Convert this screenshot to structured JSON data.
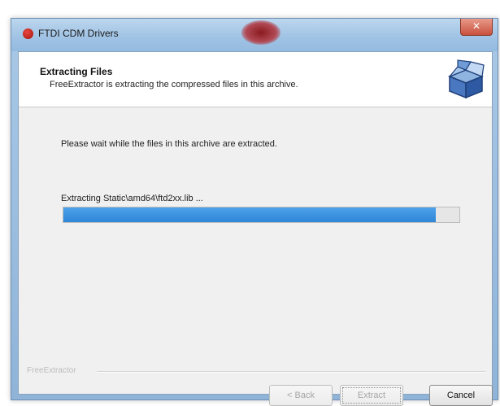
{
  "window": {
    "title": "FTDI CDM Drivers"
  },
  "header": {
    "title": "Extracting Files",
    "subtitle": "FreeExtractor is extracting the compressed files in this archive."
  },
  "body": {
    "message": "Please wait while the files in this archive are extracted."
  },
  "progress": {
    "label": "Extracting Static\\amd64\\ftd2xx.lib ...",
    "fraction": 0.94
  },
  "footer": {
    "brand": "FreeExtractor"
  },
  "buttons": {
    "back": "< Back",
    "extract": "Extract",
    "cancel": "Cancel"
  },
  "icons": {
    "app": "app-icon",
    "close": "close-icon",
    "box": "package-icon"
  },
  "colors": {
    "progress_fill": "#2f86d8",
    "titlebar": "#9fc2e4"
  }
}
